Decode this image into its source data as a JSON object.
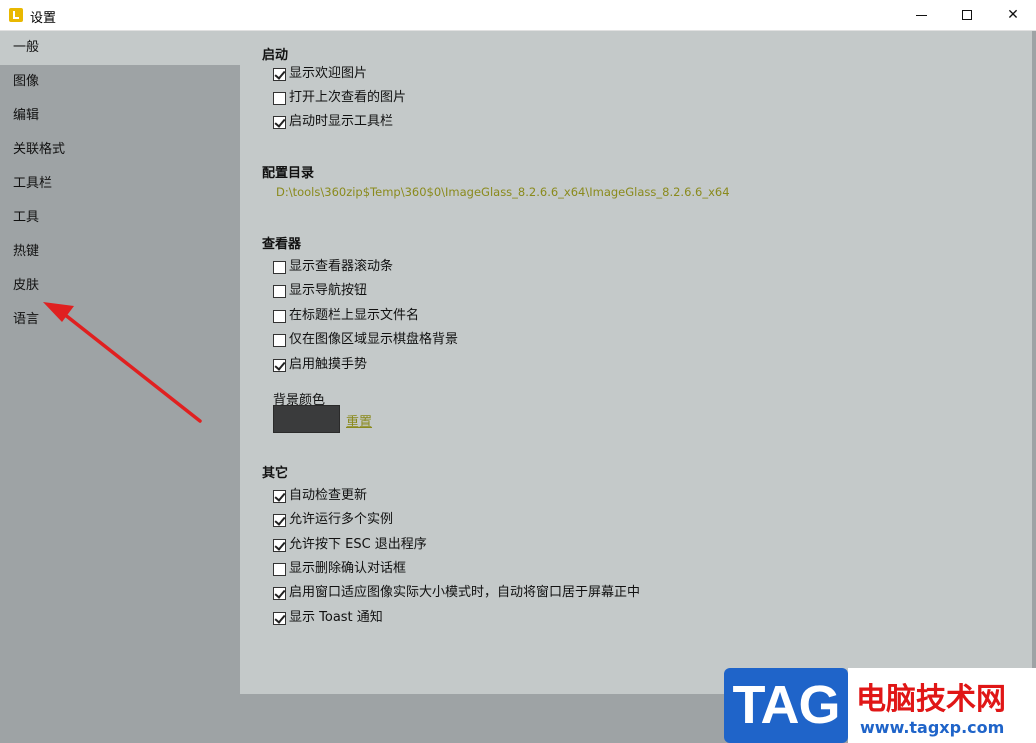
{
  "window": {
    "title": "设置",
    "min_label": "",
    "max_label": "",
    "close_label": "✕"
  },
  "sidebar": {
    "items": [
      {
        "label": "一般",
        "active": true
      },
      {
        "label": "图像",
        "active": false
      },
      {
        "label": "编辑",
        "active": false
      },
      {
        "label": "关联格式",
        "active": false
      },
      {
        "label": "工具栏",
        "active": false
      },
      {
        "label": "工具",
        "active": false
      },
      {
        "label": "热键",
        "active": false
      },
      {
        "label": "皮肤",
        "active": false
      },
      {
        "label": "语言",
        "active": false
      }
    ]
  },
  "main": {
    "startup": {
      "title": "启动",
      "options": [
        {
          "label": "显示欢迎图片",
          "checked": true
        },
        {
          "label": "打开上次查看的图片",
          "checked": false
        },
        {
          "label": "启动时显示工具栏",
          "checked": true
        }
      ]
    },
    "config_dir": {
      "title": "配置目录",
      "path": "D:\\tools\\360zip$Temp\\360$0\\ImageGlass_8.2.6.6_x64\\ImageGlass_8.2.6.6_x64"
    },
    "viewer": {
      "title": "查看器",
      "options": [
        {
          "label": "显示查看器滚动条",
          "checked": false
        },
        {
          "label": "显示导航按钮",
          "checked": false
        },
        {
          "label": "在标题栏上显示文件名",
          "checked": false
        },
        {
          "label": "仅在图像区域显示棋盘格背景",
          "checked": false
        },
        {
          "label": "启用触摸手势",
          "checked": true
        }
      ],
      "bg_color_label": "背景颜色",
      "bg_color": "#3a3b3c",
      "reset_label": "重置"
    },
    "other": {
      "title": "其它",
      "options": [
        {
          "label": "自动检查更新",
          "checked": true
        },
        {
          "label": "允许运行多个实例",
          "checked": true
        },
        {
          "label": "允许按下 ESC 退出程序",
          "checked": true
        },
        {
          "label": "显示删除确认对话框",
          "checked": false
        },
        {
          "label": "启用窗口适应图像实际大小模式时，自动将窗口居于屏幕正中",
          "checked": true
        },
        {
          "label": "显示 Toast 通知",
          "checked": true
        }
      ]
    }
  },
  "watermark": {
    "tag": "TAG",
    "site_name": "电脑技术网",
    "url": "www.tagxp.com"
  },
  "colors": {
    "accent_link": "#8a8a1c",
    "annotation_arrow": "#e02020"
  }
}
